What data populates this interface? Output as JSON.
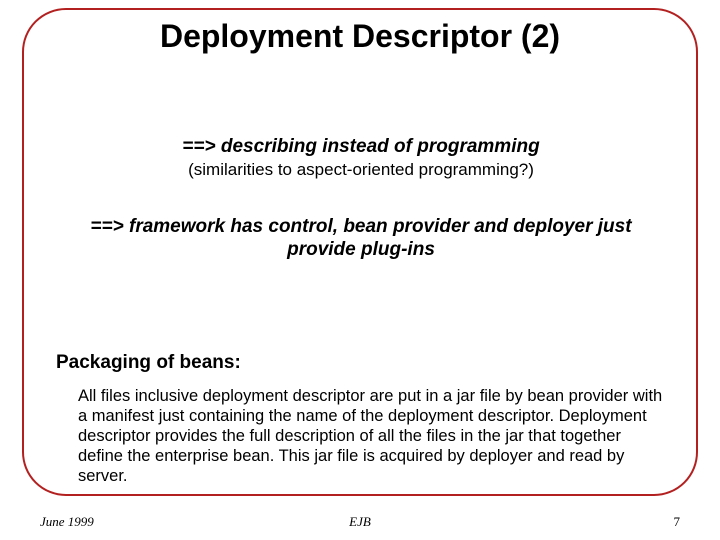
{
  "title": "Deployment Descriptor (2)",
  "point1_main": "==> describing instead of programming",
  "point1_sub": "(similarities to aspect-oriented programming?)",
  "point2": "==> framework has control, bean provider and deployer just provide plug-ins",
  "section_heading": "Packaging of beans:",
  "section_body": "All files inclusive deployment descriptor are put in a jar file by bean provider with a manifest just containing the name of the deployment descriptor. Deployment descriptor provides the full description of all the files in the jar that together define the enterprise bean. This jar file is acquired by deployer and read by server.",
  "footer": {
    "left": "June 1999",
    "center": "EJB",
    "right": "7"
  }
}
